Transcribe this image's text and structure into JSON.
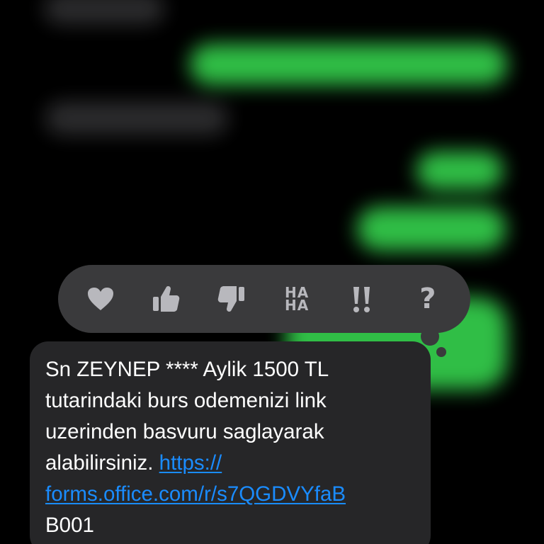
{
  "reactions": [
    {
      "name": "heart",
      "icon": "heart-icon"
    },
    {
      "name": "thumbs-up",
      "icon": "thumbs-up-icon"
    },
    {
      "name": "thumbs-down",
      "icon": "thumbs-down-icon"
    },
    {
      "name": "haha",
      "icon": "haha-icon",
      "label_top": "HA",
      "label_bottom": "HA"
    },
    {
      "name": "emphasize",
      "icon": "double-exclamation-icon"
    },
    {
      "name": "question",
      "icon": "question-mark-icon",
      "label": "?"
    }
  ],
  "message": {
    "line1": "Sn ZEYNEP **** Aylik 1500 TL",
    "line2": "tutarindaki burs odemenizi link",
    "line3": "uzerinden basvuru saglayarak",
    "line4_text": "alabilirsiniz. ",
    "link_part1": "https://",
    "link_part2": "forms.office.com/r/s7QGDVYfaB",
    "line6": "B001"
  },
  "colors": {
    "background": "#000000",
    "bubble_gray": "#262628",
    "reaction_bar": "#3a3a3c",
    "icon_gray": "#b8b8bd",
    "link_blue": "#1a8cff",
    "sent_green": "#33c94a"
  }
}
